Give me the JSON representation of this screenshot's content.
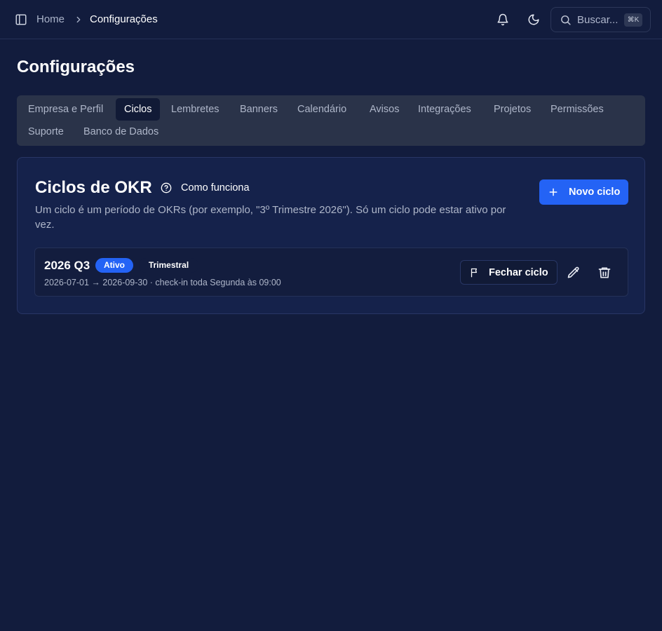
{
  "header": {
    "breadcrumb_home": "Home",
    "breadcrumb_current": "Configurações",
    "search_label": "Buscar...",
    "search_shortcut": "⌘K"
  },
  "page": {
    "title": "Configurações"
  },
  "tabs": [
    {
      "label": "Empresa e Perfil",
      "active": false
    },
    {
      "label": "Ciclos",
      "active": true
    },
    {
      "label": "Lembretes",
      "active": false
    },
    {
      "label": "Banners",
      "active": false
    },
    {
      "label": "Calendário",
      "active": false
    },
    {
      "label": "Avisos",
      "active": false
    },
    {
      "label": "Integrações",
      "active": false
    },
    {
      "label": "Projetos",
      "active": false
    },
    {
      "label": "Permissões",
      "active": false
    },
    {
      "label": "Suporte",
      "active": false
    },
    {
      "label": "Banco de Dados",
      "active": false
    }
  ],
  "cycles_card": {
    "title": "Ciclos de OKR",
    "help_label": "Como funciona",
    "description": "Um ciclo é um período de OKRs (por exemplo, \"3º Trimestre 2026\"). Só um ciclo pode estar ativo por vez.",
    "new_button_label": "Novo ciclo",
    "cycles": [
      {
        "name": "2026 Q3",
        "status_badge": "Ativo",
        "period_badge": "Trimestral",
        "meta": "2026-07-01 → 2026-09-30 · check-in toda Segunda às 09:00",
        "close_button_label": "Fechar ciclo"
      }
    ]
  },
  "colors": {
    "background": "#121c3d",
    "card": "#15224b",
    "accent": "#2463f5",
    "tabs_bg": "#2a3349"
  },
  "icons": {
    "sidebar_toggle": "panel-left-icon",
    "breadcrumb_separator": "chevron-right-icon",
    "notifications": "bell-icon",
    "theme": "moon-icon",
    "search": "search-icon",
    "help": "help-circle-icon",
    "add": "plus-icon",
    "close_cycle": "flag-icon",
    "edit": "pencil-icon",
    "delete": "trash-icon"
  }
}
